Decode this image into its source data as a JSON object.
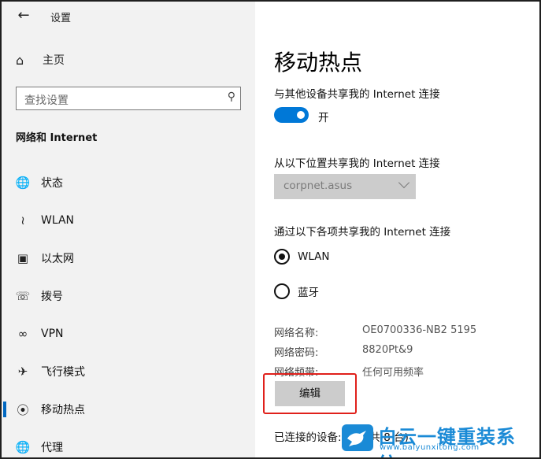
{
  "window": {
    "title": "设置"
  },
  "sidebar": {
    "home_label": "主页",
    "search_placeholder": "查找设置",
    "section_title": "网络和 Internet",
    "items": [
      {
        "label": "状态",
        "icon": "globe-status-icon"
      },
      {
        "label": "WLAN",
        "icon": "wifi-icon"
      },
      {
        "label": "以太网",
        "icon": "ethernet-icon"
      },
      {
        "label": "拨号",
        "icon": "dialup-icon"
      },
      {
        "label": "VPN",
        "icon": "vpn-icon"
      },
      {
        "label": "飞行模式",
        "icon": "airplane-icon"
      },
      {
        "label": "移动热点",
        "icon": "hotspot-icon",
        "active": true
      },
      {
        "label": "代理",
        "icon": "proxy-globe-icon"
      }
    ]
  },
  "main": {
    "title": "移动热点",
    "share_label": "与其他设备共享我的 Internet 连接",
    "toggle_state": "开",
    "from_label": "从以下位置共享我的 Internet 连接",
    "from_value": "corpnet.asus",
    "via_label": "通过以下各项共享我的 Internet 连接",
    "radio_options": [
      {
        "label": "WLAN",
        "selected": true
      },
      {
        "label": "蓝牙",
        "selected": false
      }
    ],
    "network_name_key": "网络名称:",
    "network_name_value": "OE0700336-NB2 5195",
    "network_password_key": "网络密码:",
    "network_password_value": "8820Pt&9",
    "network_band_key": "网络频带:",
    "network_band_value": "任何可用频率",
    "edit_label": "编辑",
    "connected_label": "已连接的设备:  0 台(共 8 台)"
  },
  "watermark": {
    "brand": "白云一键重装系统",
    "url": "www.baiyunxitong.com"
  },
  "colors": {
    "accent": "#0078d7",
    "highlight": "#e0201b",
    "sidebar_bg": "#f2f2f2"
  }
}
